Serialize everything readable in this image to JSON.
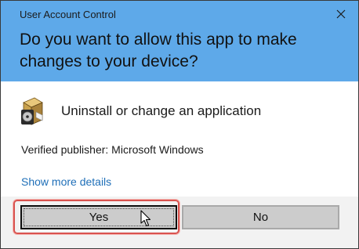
{
  "window": {
    "caption": "User Account Control",
    "close_icon": "close-icon"
  },
  "prompt": {
    "question": "Do you want to allow this app to make changes to your device?"
  },
  "app": {
    "icon": "installer-package-icon",
    "name": "Uninstall or change an application",
    "publisher": "Verified publisher: Microsoft Windows"
  },
  "details_link": "Show more details",
  "buttons": {
    "yes_label": "Yes",
    "no_label": "No"
  },
  "colors": {
    "header": "#5ea9e9",
    "link": "#1f6fb8",
    "button": "#cccccc",
    "highlight": "#d9534f"
  }
}
